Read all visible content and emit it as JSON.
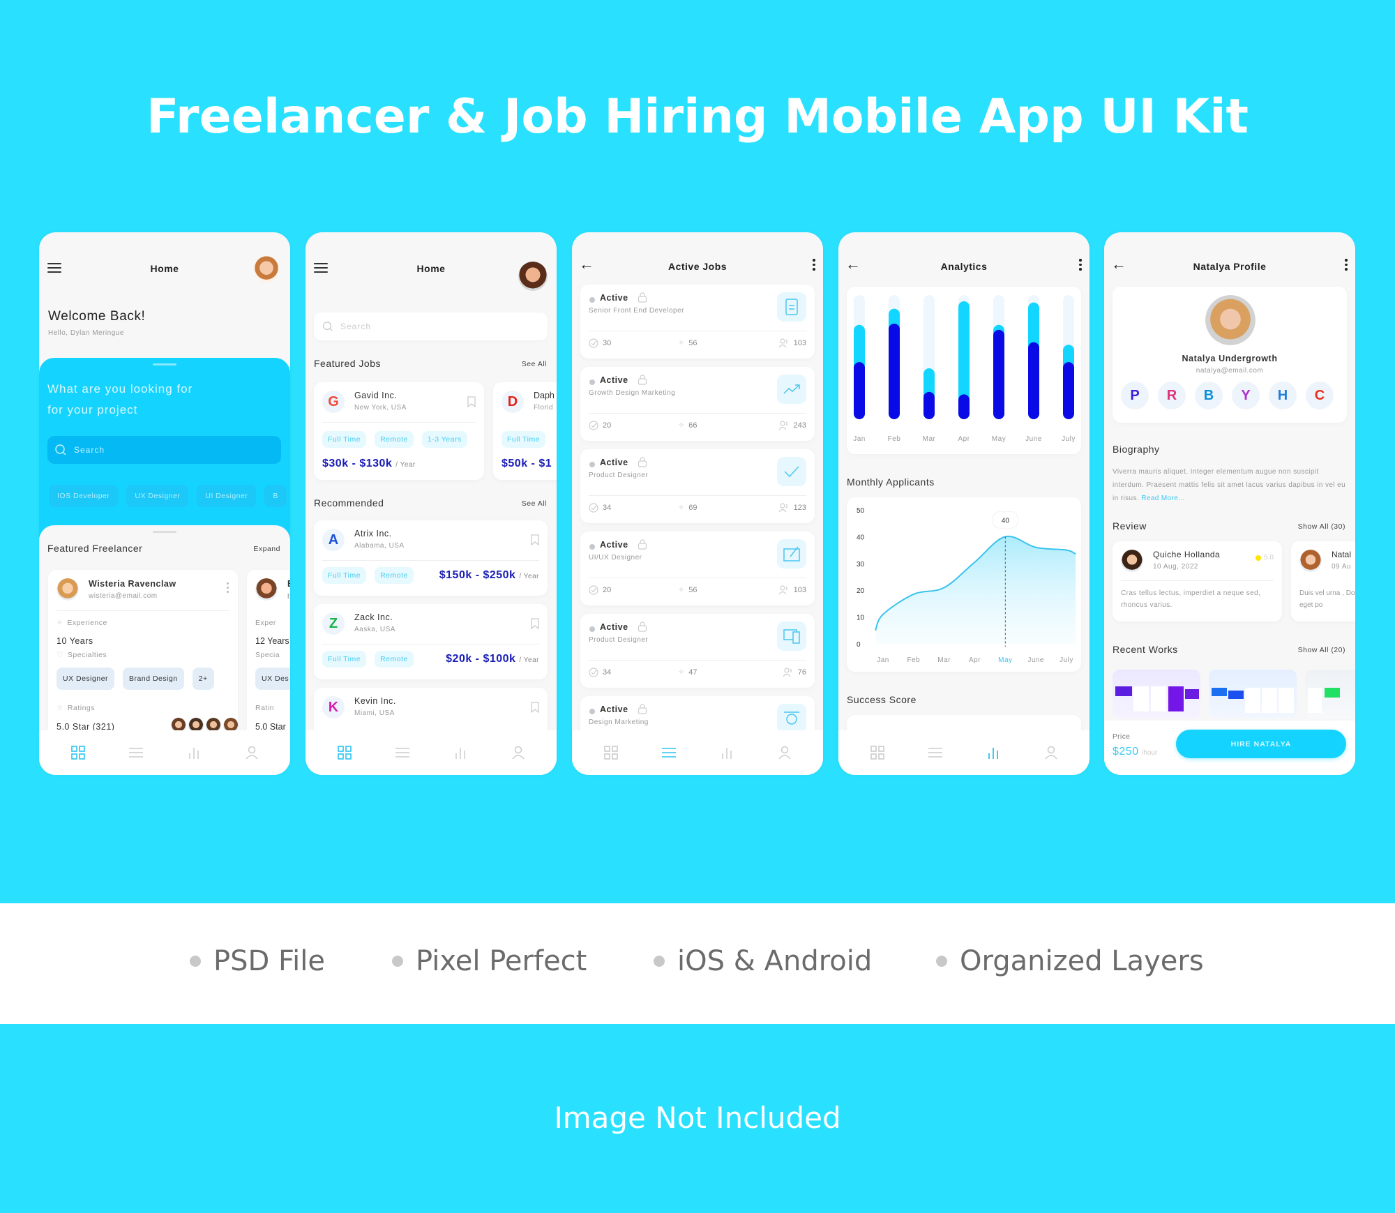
{
  "title": "Freelancer & Job Hiring Mobile App UI Kit",
  "features": [
    "PSD File",
    "Pixel Perfect",
    "iOS & Android",
    "Organized Layers"
  ],
  "footer_note": "Image Not Included",
  "colors": {
    "background": "#29e1ff",
    "accent_cyan": "#14d3ff",
    "salary_blue": "#1a1db5",
    "bar_dark": "#0a0ae6",
    "bar_light": "#12d6ff",
    "bar_track": "#eef7fd"
  },
  "screen1": {
    "header_title": "Home",
    "welcome": "Welcome Back!",
    "greeting": "Hello, Dylan Meringue",
    "hero_title_line1": "What are you looking for",
    "hero_title_line2": "for your project",
    "search_placeholder": "Search",
    "categories": [
      "IOS Developer",
      "UX Designer",
      "UI Designer",
      "B"
    ],
    "featured_title": "Featured Freelancer",
    "expand_label": "Expand",
    "freelancers": [
      {
        "name": "Wisteria Ravenclaw",
        "email": "wisteria@email.com",
        "experience_label": "Experience",
        "experience": "10 Years",
        "specialties_label": "Specialties",
        "specialties": [
          "UX Designer",
          "Brand Design",
          "2+"
        ],
        "ratings_label": "Ratings",
        "rating": "5.0 Star (321)"
      },
      {
        "name": "B",
        "email": "b",
        "experience_label": "Exper",
        "experience": "12 Years",
        "specialties_label": "Specia",
        "specialties": [
          "UX Des"
        ],
        "ratings_label": "Ratin",
        "rating": "5.0 Star"
      }
    ]
  },
  "screen2": {
    "header_title": "Home",
    "search_placeholder": "Search",
    "featured_title": "Featured Jobs",
    "featured_see_all": "See All",
    "featured_jobs": [
      {
        "logo": "G",
        "company": "Gavid Inc.",
        "location": "New York, USA",
        "tags": [
          "Full Time",
          "Remote",
          "1-3 Years"
        ],
        "salary": "$30k - $130k",
        "period": "/ Year"
      },
      {
        "logo": "D",
        "company": "Daph",
        "location": "Florid",
        "tags": [
          "Full Time"
        ],
        "salary": "$50k - $1",
        "period": ""
      }
    ],
    "recommended_title": "Recommended",
    "recommended_see_all": "See All",
    "recommended_jobs": [
      {
        "logo": "A",
        "company": "Atrix Inc.",
        "location": "Alabama, USA",
        "tags": [
          "Full Time",
          "Remote"
        ],
        "salary": "$150k - $250k",
        "period": "/ Year"
      },
      {
        "logo": "Z",
        "company": "Zack Inc.",
        "location": "Aaska, USA",
        "tags": [
          "Full Time",
          "Remote"
        ],
        "salary": "$20k - $100k",
        "period": "/ Year"
      },
      {
        "logo": "K",
        "company": "Kevin Inc.",
        "location": "Miami, USA",
        "tags": [],
        "salary": "",
        "period": ""
      }
    ]
  },
  "screen3": {
    "header_title": "Active Jobs",
    "jobs": [
      {
        "status": "Active",
        "title": "Senior Front End Developer",
        "icon": "document-icon",
        "completed": "30",
        "shortlisted": "56",
        "applicants": "103"
      },
      {
        "status": "Active",
        "title": "Growth Design Marketing",
        "icon": "trend-up-icon",
        "completed": "20",
        "shortlisted": "66",
        "applicants": "243"
      },
      {
        "status": "Active",
        "title": "Product Designer",
        "icon": "check-icon",
        "completed": "34",
        "shortlisted": "69",
        "applicants": "123"
      },
      {
        "status": "Active",
        "title": "UI/UX Designer",
        "icon": "drawing-tablet-icon",
        "completed": "20",
        "shortlisted": "56",
        "applicants": "103"
      },
      {
        "status": "Active",
        "title": "Product Designer",
        "icon": "devices-icon",
        "completed": "34",
        "shortlisted": "47",
        "applicants": "76"
      },
      {
        "status": "Active",
        "title": "Design Marketing",
        "icon": "pen-tool-icon",
        "completed": "",
        "shortlisted": "",
        "applicants": ""
      }
    ]
  },
  "screen4": {
    "header_title": "Analytics",
    "monthly_title": "Monthly Applicants",
    "success_title": "Success Score",
    "tooltip_value": "40",
    "highlight_month": "May"
  },
  "chart_data": [
    {
      "type": "bar",
      "title": "",
      "categories": [
        "Jan",
        "Feb",
        "Mar",
        "Apr",
        "May",
        "June",
        "July"
      ],
      "series": [
        {
          "name": "total",
          "values": [
            0.76,
            0.89,
            0.41,
            0.95,
            0.76,
            0.94,
            0.6
          ]
        },
        {
          "name": "portion",
          "values": [
            0.46,
            0.77,
            0.22,
            0.2,
            0.72,
            0.62,
            0.46
          ]
        }
      ],
      "ylim": [
        0,
        1
      ],
      "grid": false,
      "legend": "none"
    },
    {
      "type": "area",
      "title": "Monthly Applicants",
      "categories": [
        "Jan",
        "Feb",
        "Mar",
        "Apr",
        "May",
        "June",
        "July"
      ],
      "x": [
        -0.25,
        0,
        1,
        2,
        3,
        4,
        5,
        6,
        6.3
      ],
      "values": [
        5,
        11,
        18.5,
        21,
        30.5,
        40,
        36,
        35,
        33.5
      ],
      "yticks": [
        0,
        10,
        20,
        30,
        40,
        50
      ],
      "ylim": [
        0,
        50
      ],
      "annotation": {
        "month": "May",
        "value": 40
      },
      "grid": false,
      "legend": "none"
    }
  ],
  "screen5": {
    "header_title": "Natalya Profile",
    "name": "Natalya Undergrowth",
    "email": "natalya@email.com",
    "skills": [
      "P",
      "R",
      "B",
      "Y",
      "H",
      "C"
    ],
    "biography_title": "Biography",
    "biography": "Viverra mauris  aliquet. Integer elementum augue non suscipit interdum. Praesent mattis felis sit amet lacus varius dapibus in vel  eu in risus.",
    "read_more": "Read More...",
    "review_title": "Review",
    "review_show_all": "Show All (30)",
    "reviews": [
      {
        "name": "Quiche Hollanda",
        "date": "10 Aug, 2022",
        "rating": "5.0",
        "text": "Cras tellus lectus, imperdiet a neque sed, rhoncus varius."
      },
      {
        "name": "Natal",
        "date": "09 Au",
        "rating": "",
        "text": "Duis vel urna , Donec eget po"
      }
    ],
    "works_title": "Recent Works",
    "works_show_all": "Show All (20)",
    "price_label": "Price",
    "price": "$250",
    "price_unit": "/hour",
    "hire_button": "HIRE NATALYA"
  }
}
